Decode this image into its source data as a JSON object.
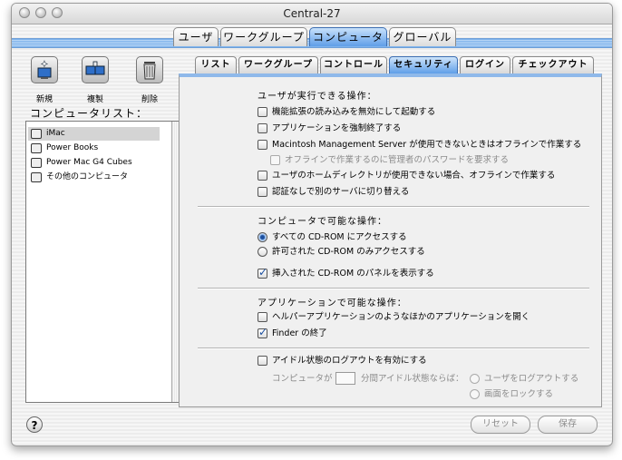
{
  "window": {
    "title": "Central-27"
  },
  "main_tabs": [
    {
      "label": "ユーザ",
      "active": false
    },
    {
      "label": "ワークグループ",
      "active": false
    },
    {
      "label": "コンピュータ",
      "active": true
    },
    {
      "label": "グローバル",
      "active": false
    }
  ],
  "toolbar": [
    {
      "label": "新規",
      "icon": "new-computer-icon"
    },
    {
      "label": "複製",
      "icon": "duplicate-computer-icon"
    },
    {
      "label": "削除",
      "icon": "trash-icon"
    }
  ],
  "computer_list": {
    "caption": "コンピュータリスト：",
    "items": [
      {
        "label": "iMac",
        "selected": true
      },
      {
        "label": "Power Books",
        "selected": false
      },
      {
        "label": "Power Mac G4 Cubes",
        "selected": false
      },
      {
        "label": "その他のコンピュータ",
        "selected": false
      }
    ]
  },
  "sub_tabs": [
    {
      "label": "リスト",
      "active": false
    },
    {
      "label": "ワークグループ",
      "active": false
    },
    {
      "label": "コントロール",
      "active": false
    },
    {
      "label": "セキュリティ",
      "active": true
    },
    {
      "label": "ログイン",
      "active": false
    },
    {
      "label": "チェックアウト",
      "active": false
    }
  ],
  "sections": {
    "user_ops": {
      "title": "ユーザが実行できる操作：",
      "options": [
        {
          "label": "機能拡張の読み込みを無効にして起動する",
          "checked": false,
          "enabled": true
        },
        {
          "label": "アプリケーションを強制終了する",
          "checked": false,
          "enabled": true
        },
        {
          "label": "Macintosh Management Server が使用できないときはオフラインで作業する",
          "checked": false,
          "enabled": true
        },
        {
          "label": "オフラインで作業するのに管理者のパスワードを要求する",
          "checked": false,
          "enabled": false
        },
        {
          "label": "ユーザのホームディレクトリが使用できない場合、オフラインで作業する",
          "checked": false,
          "enabled": true
        },
        {
          "label": "認証なしで別のサーバに切り替える",
          "checked": false,
          "enabled": true
        }
      ]
    },
    "computer_ops": {
      "title": "コンピュータで可能な操作：",
      "radios": [
        {
          "label": "すべての CD-ROM にアクセスする",
          "selected": true
        },
        {
          "label": "許可された CD-ROM のみアクセスする",
          "selected": false
        }
      ],
      "checkbox": {
        "label": "挿入された CD-ROM のパネルを表示する",
        "checked": true
      }
    },
    "app_ops": {
      "title": "アプリケーションで可能な操作：",
      "options": [
        {
          "label": "ヘルパーアプリケーションのようなほかのアプリケーションを開く",
          "checked": false
        },
        {
          "label": "Finder の終了",
          "checked": true
        }
      ]
    },
    "idle_logout": {
      "checkbox_label": "アイドル状態のログアウトを有効にする",
      "checked": false,
      "prefix": "コンピュータが",
      "minutes_value": "",
      "suffix": "分間アイドル状態ならば：",
      "radios": [
        {
          "label": "ユーザをログアウトする",
          "selected": false
        },
        {
          "label": "画面をロックする",
          "selected": false
        }
      ]
    }
  },
  "footer": {
    "help_label": "?",
    "revert_label": "リセット",
    "save_label": "保存"
  }
}
